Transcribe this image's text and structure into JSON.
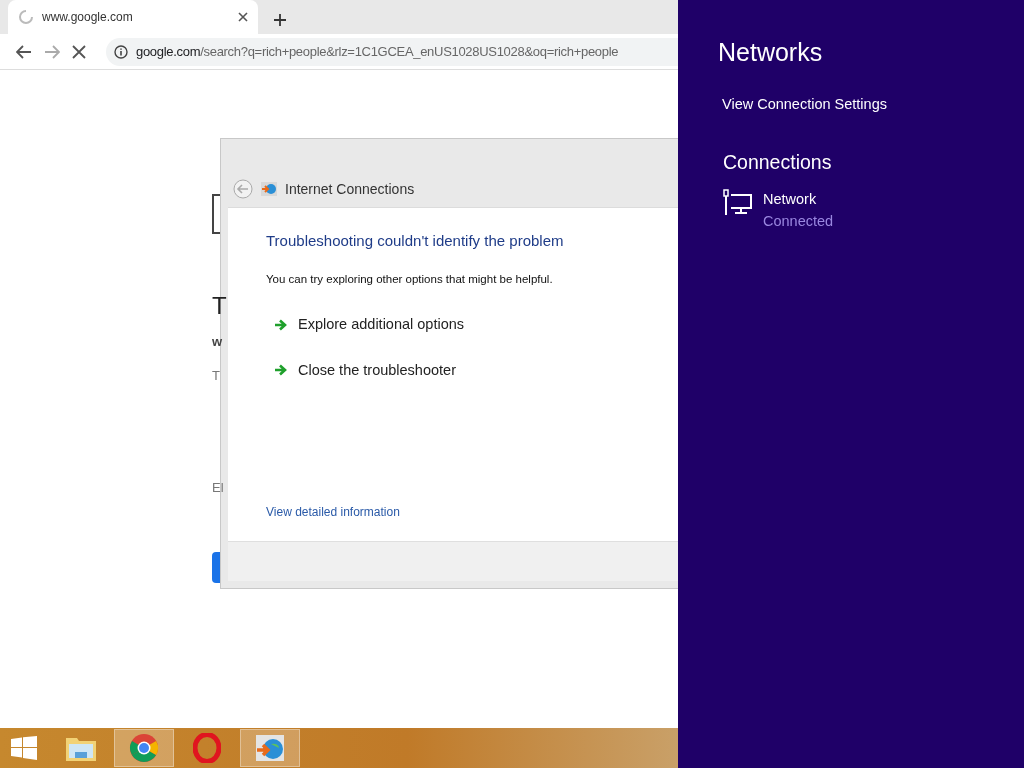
{
  "browser": {
    "tab": {
      "title": "www.google.com",
      "loading": true
    },
    "address": {
      "host": "google.com",
      "path": "/search?q=rich+people&rlz=1C1GCEA_enUS1028US1028&oq=rich+people"
    },
    "page_fragments": [
      {
        "kind": "heading",
        "text": "T"
      },
      {
        "kind": "bold",
        "text": "w"
      },
      {
        "kind": "plain",
        "text": "T"
      },
      {
        "kind": "plain",
        "text": "El"
      }
    ]
  },
  "dialog": {
    "title": "Internet Connections",
    "heading": "Troubleshooting couldn't identify the problem",
    "message": "You can try exploring other options that might be helpful.",
    "options": [
      "Explore additional options",
      "Close the troubleshooter"
    ],
    "link": "View detailed information"
  },
  "networks_panel": {
    "title": "Networks",
    "settings_link": "View Connection Settings",
    "section": "Connections",
    "connections": [
      {
        "name": "Network",
        "status": "Connected"
      }
    ]
  },
  "taskbar": {
    "items": [
      {
        "kind": "start",
        "selected": false
      },
      {
        "kind": "explorer",
        "selected": false
      },
      {
        "kind": "chrome",
        "selected": true
      },
      {
        "kind": "opera",
        "selected": false
      },
      {
        "kind": "network",
        "selected": true
      }
    ]
  }
}
